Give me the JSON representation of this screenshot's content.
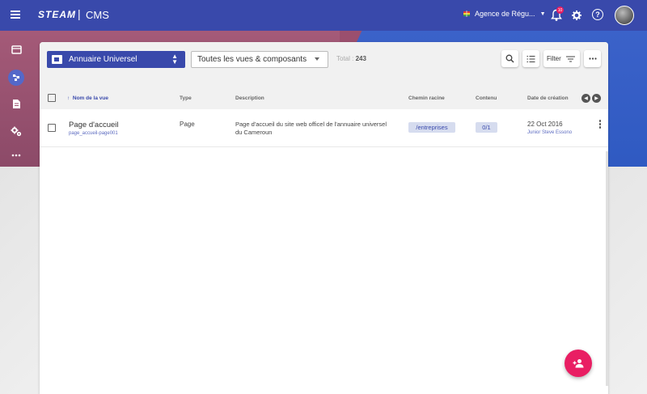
{
  "topbar": {
    "brand": "STEAM",
    "separator": "|",
    "app": "CMS",
    "agency": "Agence de Régu...",
    "notifications_count": "10",
    "help_label": "?"
  },
  "toolbar": {
    "directory_select": "Annuaire Universel",
    "views_select": "Toutes les vues & composants",
    "total_label": "Total :",
    "total_value": "243",
    "filter_label": "Filter"
  },
  "table": {
    "columns": {
      "name": "Nom de la vue",
      "type": "Type",
      "description": "Description",
      "root_path": "Chemin racine",
      "content": "Contenu",
      "created": "Date de création"
    },
    "rows": [
      {
        "name": "Page d'accueil",
        "slug": "page_accueil-page001",
        "type": "Page",
        "description": "Page d'accueil du site web officel de l'annuaire universel du Cameroun",
        "root_path": "/entreprises",
        "content": "0/1",
        "date": "22 Oct 2016",
        "author": "Junior Steve Essono"
      }
    ]
  },
  "colors": {
    "primary": "#3949ab",
    "accent": "#e91e63",
    "chip_bg": "#d6dcef"
  },
  "icons": {
    "menu": "menu-icon",
    "search": "search-icon",
    "list": "list-icon",
    "filter": "filter-icon",
    "more": "more-horiz-icon",
    "fab": "add-user-icon"
  }
}
